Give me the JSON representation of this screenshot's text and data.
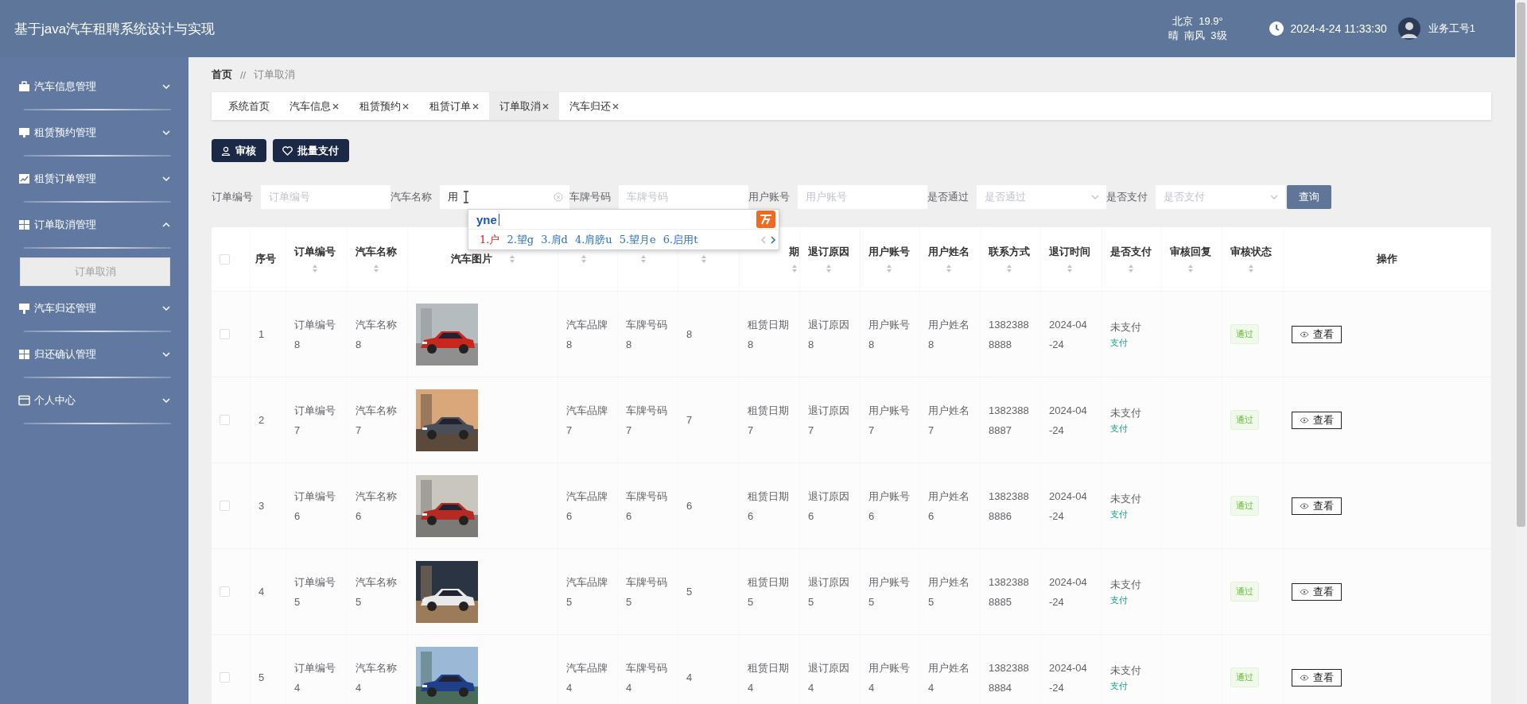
{
  "header": {
    "title": "基于java汽车租聘系统设计与实现",
    "weather": {
      "city": "北京",
      "temperature": "19.9°",
      "condition": "晴",
      "wind": "南风",
      "wind_force": "3级"
    },
    "datetime": "2024-4-24 11:33:30",
    "user": "业务工号1"
  },
  "sidebar": {
    "items": [
      {
        "label": "汽车信息管理",
        "expanded": false
      },
      {
        "label": "租赁预约管理",
        "expanded": false
      },
      {
        "label": "租赁订单管理",
        "expanded": false
      },
      {
        "label": "订单取消管理",
        "expanded": true,
        "children": [
          {
            "label": "订单取消",
            "selected": true
          }
        ]
      },
      {
        "label": "汽车归还管理",
        "expanded": false
      },
      {
        "label": "归还确认管理",
        "expanded": false
      },
      {
        "label": "个人中心",
        "expanded": false
      }
    ]
  },
  "breadcrumb": {
    "items": [
      "首页",
      "订单取消"
    ],
    "separator": "//"
  },
  "tabs": [
    {
      "label": "系统首页",
      "closable": false,
      "selected": false
    },
    {
      "label": "汽车信息",
      "closable": true,
      "selected": false
    },
    {
      "label": "租赁预约",
      "closable": true,
      "selected": false
    },
    {
      "label": "租赁订单",
      "closable": true,
      "selected": false
    },
    {
      "label": "订单取消",
      "closable": true,
      "selected": true
    },
    {
      "label": "汽车归还",
      "closable": true,
      "selected": false
    }
  ],
  "toolbar": [
    {
      "label": "审核",
      "kind": "audit"
    },
    {
      "label": "批量支付",
      "kind": "pay"
    }
  ],
  "filters": [
    {
      "label": "订单编号",
      "kind": "text",
      "placeholder": "订单编号"
    },
    {
      "label": "汽车名称",
      "kind": "text",
      "value": "用",
      "clearable": true
    },
    {
      "label": "车牌号码",
      "kind": "text",
      "placeholder": "车牌号码"
    },
    {
      "label": "用户账号",
      "kind": "text",
      "placeholder": "用户账号"
    },
    {
      "label": "是否通过",
      "kind": "select",
      "placeholder": "是否通过"
    },
    {
      "label": "是否支付",
      "kind": "select",
      "placeholder": "是否支付"
    }
  ],
  "search_button": "查询",
  "ime": {
    "composition": "yne",
    "candidates": [
      {
        "text": "1.户",
        "selected": true
      },
      {
        "text": "2.望g",
        "selected": false
      },
      {
        "text": "3.肩d",
        "selected": false
      },
      {
        "text": "4.肩膀u",
        "selected": false
      },
      {
        "text": "5.望月e",
        "selected": false
      },
      {
        "text": "6.启用t",
        "selected": false
      }
    ]
  },
  "table": {
    "columns": [
      {
        "kind": "checkbox",
        "checked": false
      },
      {
        "kind": "index",
        "label": "序号",
        "sortable": false
      },
      {
        "kind": "text",
        "label": "订单编号",
        "sortable": true
      },
      {
        "kind": "text",
        "label": "汽车名称",
        "sortable": true
      },
      {
        "label": "汽车图片",
        "sortable": true
      },
      {
        "kind": "text",
        "sortable": true
      },
      {
        "kind": "text",
        "sortable": true
      },
      {
        "kind": "text",
        "sortable": true
      },
      {
        "kind": "text",
        "label": "期",
        "sortable": true,
        "covered_left": true
      },
      {
        "kind": "text",
        "label": "退订原因",
        "sortable": true
      },
      {
        "kind": "text",
        "label": "用户账号",
        "sortable": true
      },
      {
        "kind": "text",
        "label": "用户姓名",
        "sortable": true
      },
      {
        "kind": "text",
        "label": "联系方式",
        "sortable": true
      },
      {
        "kind": "text",
        "label": "退订时间",
        "sortable": true
      },
      {
        "kind": "text",
        "label": "是否支付",
        "sortable": true
      },
      {
        "kind": "text",
        "label": "审核回复",
        "sortable": true
      },
      {
        "kind": "text",
        "label": "审核状态",
        "sortable": true
      },
      {
        "kind": "action",
        "label": "操作",
        "sortable": false
      }
    ],
    "rows": [
      {
        "checked": false,
        "index": "1",
        "order_no": "订单编号8",
        "car_name": "汽车名称8",
        "brand": "汽车品牌8",
        "plate": "车牌号码8",
        "column_7": "8",
        "rent_date": "租赁日期8",
        "cancel_reason": "退订原因8",
        "account": "用户账号8",
        "user_name": "用户姓名8",
        "phone": "13823888888",
        "cancel_time": "2024-04-24",
        "payment": {
          "status": "未支付",
          "action": "支付"
        },
        "status": "通过",
        "action": "查看"
      },
      {
        "checked": false,
        "index": "2",
        "order_no": "订单编号7",
        "car_name": "汽车名称7",
        "brand": "汽车品牌7",
        "plate": "车牌号码7",
        "column_7": "7",
        "rent_date": "租赁日期7",
        "cancel_reason": "退订原因7",
        "account": "用户账号7",
        "user_name": "用户姓名7",
        "phone": "13823888887",
        "cancel_time": "2024-04-24",
        "payment": {
          "status": "未支付",
          "action": "支付"
        },
        "status": "通过",
        "action": "查看"
      },
      {
        "checked": false,
        "index": "3",
        "order_no": "订单编号6",
        "car_name": "汽车名称6",
        "brand": "汽车品牌6",
        "plate": "车牌号码6",
        "column_7": "6",
        "rent_date": "租赁日期6",
        "cancel_reason": "退订原因6",
        "account": "用户账号6",
        "user_name": "用户姓名6",
        "phone": "13823888886",
        "cancel_time": "2024-04-24",
        "payment": {
          "status": "未支付",
          "action": "支付"
        },
        "status": "通过",
        "action": "查看"
      },
      {
        "checked": false,
        "index": "4",
        "order_no": "订单编号5",
        "car_name": "汽车名称5",
        "brand": "汽车品牌5",
        "plate": "车牌号码5",
        "column_7": "5",
        "rent_date": "租赁日期5",
        "cancel_reason": "退订原因5",
        "account": "用户账号5",
        "user_name": "用户姓名5",
        "phone": "13823888885",
        "cancel_time": "2024-04-24",
        "payment": {
          "status": "未支付",
          "action": "支付"
        },
        "status": "通过",
        "action": "查看"
      },
      {
        "checked": false,
        "index": "5",
        "order_no": "订单编号4",
        "car_name": "汽车名称4",
        "brand": "汽车品牌4",
        "plate": "车牌号码4",
        "column_7": "4",
        "rent_date": "租赁日期4",
        "cancel_reason": "退订原因4",
        "account": "用户账号4",
        "user_name": "用户姓名4",
        "phone": "13823888884",
        "cancel_time": "2024-04-24",
        "payment": {
          "status": "未支付",
          "action": "支付"
        },
        "status": "通过",
        "action": "查看"
      }
    ]
  }
}
